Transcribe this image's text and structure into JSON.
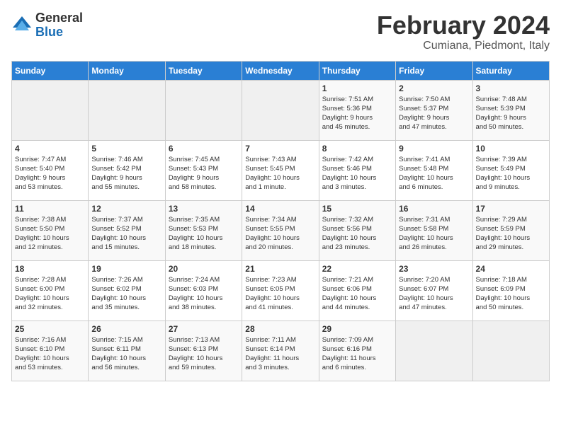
{
  "header": {
    "logo_line1": "General",
    "logo_line2": "Blue",
    "title": "February 2024",
    "subtitle": "Cumiana, Piedmont, Italy"
  },
  "weekdays": [
    "Sunday",
    "Monday",
    "Tuesday",
    "Wednesday",
    "Thursday",
    "Friday",
    "Saturday"
  ],
  "weeks": [
    [
      {
        "day": "",
        "info": ""
      },
      {
        "day": "",
        "info": ""
      },
      {
        "day": "",
        "info": ""
      },
      {
        "day": "",
        "info": ""
      },
      {
        "day": "1",
        "info": "Sunrise: 7:51 AM\nSunset: 5:36 PM\nDaylight: 9 hours\nand 45 minutes."
      },
      {
        "day": "2",
        "info": "Sunrise: 7:50 AM\nSunset: 5:37 PM\nDaylight: 9 hours\nand 47 minutes."
      },
      {
        "day": "3",
        "info": "Sunrise: 7:48 AM\nSunset: 5:39 PM\nDaylight: 9 hours\nand 50 minutes."
      }
    ],
    [
      {
        "day": "4",
        "info": "Sunrise: 7:47 AM\nSunset: 5:40 PM\nDaylight: 9 hours\nand 53 minutes."
      },
      {
        "day": "5",
        "info": "Sunrise: 7:46 AM\nSunset: 5:42 PM\nDaylight: 9 hours\nand 55 minutes."
      },
      {
        "day": "6",
        "info": "Sunrise: 7:45 AM\nSunset: 5:43 PM\nDaylight: 9 hours\nand 58 minutes."
      },
      {
        "day": "7",
        "info": "Sunrise: 7:43 AM\nSunset: 5:45 PM\nDaylight: 10 hours\nand 1 minute."
      },
      {
        "day": "8",
        "info": "Sunrise: 7:42 AM\nSunset: 5:46 PM\nDaylight: 10 hours\nand 3 minutes."
      },
      {
        "day": "9",
        "info": "Sunrise: 7:41 AM\nSunset: 5:48 PM\nDaylight: 10 hours\nand 6 minutes."
      },
      {
        "day": "10",
        "info": "Sunrise: 7:39 AM\nSunset: 5:49 PM\nDaylight: 10 hours\nand 9 minutes."
      }
    ],
    [
      {
        "day": "11",
        "info": "Sunrise: 7:38 AM\nSunset: 5:50 PM\nDaylight: 10 hours\nand 12 minutes."
      },
      {
        "day": "12",
        "info": "Sunrise: 7:37 AM\nSunset: 5:52 PM\nDaylight: 10 hours\nand 15 minutes."
      },
      {
        "day": "13",
        "info": "Sunrise: 7:35 AM\nSunset: 5:53 PM\nDaylight: 10 hours\nand 18 minutes."
      },
      {
        "day": "14",
        "info": "Sunrise: 7:34 AM\nSunset: 5:55 PM\nDaylight: 10 hours\nand 20 minutes."
      },
      {
        "day": "15",
        "info": "Sunrise: 7:32 AM\nSunset: 5:56 PM\nDaylight: 10 hours\nand 23 minutes."
      },
      {
        "day": "16",
        "info": "Sunrise: 7:31 AM\nSunset: 5:58 PM\nDaylight: 10 hours\nand 26 minutes."
      },
      {
        "day": "17",
        "info": "Sunrise: 7:29 AM\nSunset: 5:59 PM\nDaylight: 10 hours\nand 29 minutes."
      }
    ],
    [
      {
        "day": "18",
        "info": "Sunrise: 7:28 AM\nSunset: 6:00 PM\nDaylight: 10 hours\nand 32 minutes."
      },
      {
        "day": "19",
        "info": "Sunrise: 7:26 AM\nSunset: 6:02 PM\nDaylight: 10 hours\nand 35 minutes."
      },
      {
        "day": "20",
        "info": "Sunrise: 7:24 AM\nSunset: 6:03 PM\nDaylight: 10 hours\nand 38 minutes."
      },
      {
        "day": "21",
        "info": "Sunrise: 7:23 AM\nSunset: 6:05 PM\nDaylight: 10 hours\nand 41 minutes."
      },
      {
        "day": "22",
        "info": "Sunrise: 7:21 AM\nSunset: 6:06 PM\nDaylight: 10 hours\nand 44 minutes."
      },
      {
        "day": "23",
        "info": "Sunrise: 7:20 AM\nSunset: 6:07 PM\nDaylight: 10 hours\nand 47 minutes."
      },
      {
        "day": "24",
        "info": "Sunrise: 7:18 AM\nSunset: 6:09 PM\nDaylight: 10 hours\nand 50 minutes."
      }
    ],
    [
      {
        "day": "25",
        "info": "Sunrise: 7:16 AM\nSunset: 6:10 PM\nDaylight: 10 hours\nand 53 minutes."
      },
      {
        "day": "26",
        "info": "Sunrise: 7:15 AM\nSunset: 6:11 PM\nDaylight: 10 hours\nand 56 minutes."
      },
      {
        "day": "27",
        "info": "Sunrise: 7:13 AM\nSunset: 6:13 PM\nDaylight: 10 hours\nand 59 minutes."
      },
      {
        "day": "28",
        "info": "Sunrise: 7:11 AM\nSunset: 6:14 PM\nDaylight: 11 hours\nand 3 minutes."
      },
      {
        "day": "29",
        "info": "Sunrise: 7:09 AM\nSunset: 6:16 PM\nDaylight: 11 hours\nand 6 minutes."
      },
      {
        "day": "",
        "info": ""
      },
      {
        "day": "",
        "info": ""
      }
    ]
  ]
}
